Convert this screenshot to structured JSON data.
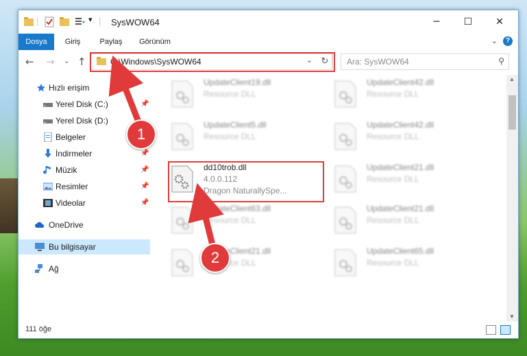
{
  "window": {
    "title": "SysWOW64"
  },
  "ribbon": {
    "tabs": [
      "Dosya",
      "Giriş",
      "Paylaş",
      "Görünüm"
    ],
    "help": "?"
  },
  "address": {
    "path": "C:\\Windows\\SysWOW64"
  },
  "search": {
    "placeholder": "Ara: SysWOW64"
  },
  "sidebar": {
    "items": [
      {
        "label": "Hızlı erişim"
      },
      {
        "label": "Yerel Disk (C:)"
      },
      {
        "label": "Yerel Disk (D:)"
      },
      {
        "label": "Belgeler"
      },
      {
        "label": "İndirmeler"
      },
      {
        "label": "Müzik"
      },
      {
        "label": "Resimler"
      },
      {
        "label": "Videolar"
      },
      {
        "label": "OneDrive"
      },
      {
        "label": "Bu bilgisayar"
      },
      {
        "label": "Ağ"
      }
    ]
  },
  "files": [
    {
      "name": "UpdateClient19.dll",
      "type": "Resource DLL"
    },
    {
      "name": "UpdateClient42.dll",
      "type": "Resource DLL"
    },
    {
      "name": "UpdateClient5.dll",
      "type": "Resource DLL"
    },
    {
      "name": "UpdateClient42.dll",
      "type": "Resource DLL"
    },
    {
      "name": "dd10trob.dll",
      "version": "4.0.0.112",
      "description": "Dragon NaturallySpe..."
    },
    {
      "name": "UpdateClient21.dll",
      "type": "Resource DLL"
    },
    {
      "name": "UpdateClient63.dll",
      "type": "Resource DLL"
    },
    {
      "name": "UpdateClient21.dll",
      "type": "Resource DLL"
    },
    {
      "name": "UpdateClient21.dll",
      "type": "Resource DLL"
    },
    {
      "name": "UpdateClient65.dll",
      "type": "Resource DLL"
    }
  ],
  "status": {
    "count": "111 öğe"
  },
  "annotations": {
    "step1": "1",
    "step2": "2"
  },
  "colors": {
    "accent": "#1979ca",
    "highlight": "#e03a3a",
    "selected": "#cce8ff"
  }
}
